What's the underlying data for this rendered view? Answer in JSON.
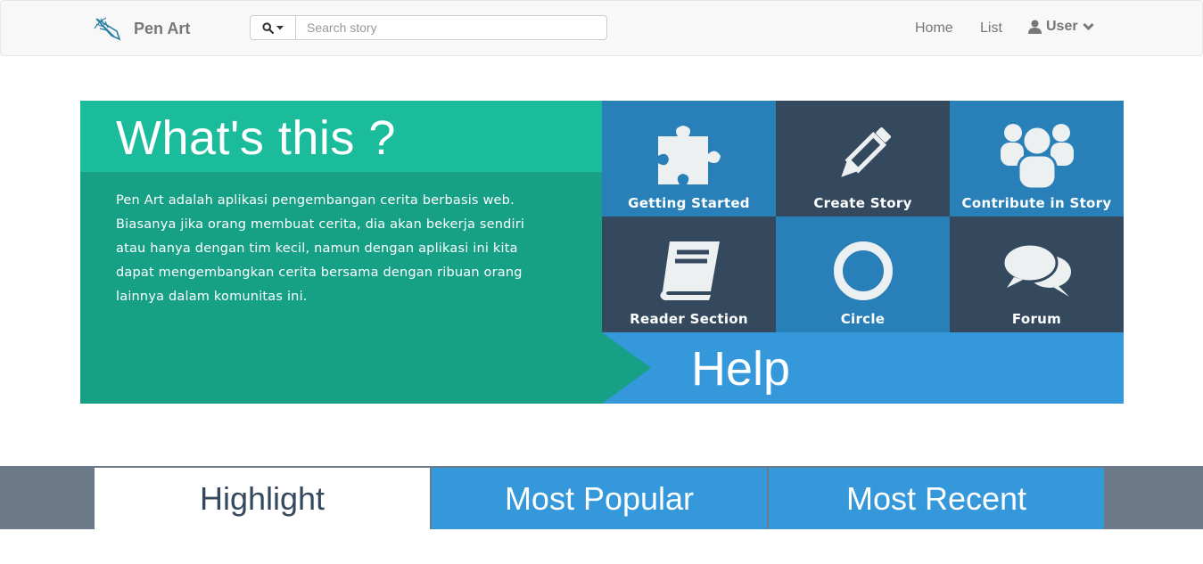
{
  "navbar": {
    "brand_name": "Pen Art",
    "search": {
      "placeholder": "Search story",
      "value": ""
    },
    "links": {
      "home": "Home",
      "list": "List",
      "user": "User"
    }
  },
  "hero": {
    "title": "What's this ?",
    "description": "Pen Art adalah aplikasi pengembangan cerita berbasis web. Biasanya jika orang membuat cerita, dia akan bekerja sendiri atau hanya dengan tim kecil, namun dengan aplikasi ini kita dapat mengembangkan cerita bersama dengan ribuan orang lainnya dalam komunitas ini."
  },
  "tiles": [
    {
      "label": "Getting Started",
      "icon": "puzzle-icon"
    },
    {
      "label": "Create Story",
      "icon": "pencil-icon"
    },
    {
      "label": "Contribute in Story",
      "icon": "users-icon"
    },
    {
      "label": "Reader Section",
      "icon": "book-icon"
    },
    {
      "label": "Circle",
      "icon": "circle-icon"
    },
    {
      "label": "Forum",
      "icon": "chat-bubbles-icon"
    }
  ],
  "help": {
    "label": "Help"
  },
  "tabs": [
    {
      "label": "Highlight",
      "active": true
    },
    {
      "label": "Most Popular",
      "active": false
    },
    {
      "label": "Most Recent",
      "active": false
    }
  ],
  "colors": {
    "teal": "#1abc9c",
    "teal_dark": "#16a085",
    "blue": "#2980b9",
    "blue_light": "#3498db",
    "navy": "#34495e",
    "slate": "#6c7a89"
  }
}
